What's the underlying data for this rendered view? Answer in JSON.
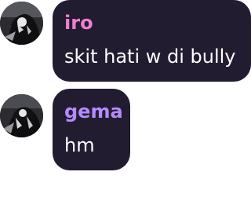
{
  "colors": {
    "bubble_bg": "#221c30",
    "message_text": "#ffffff"
  },
  "messages": [
    {
      "author": "iro",
      "author_color": "#ee7fd1",
      "text": "skit hati w di bully",
      "avatar_icon": "avatar-dark-character-icon"
    },
    {
      "author": "gema",
      "author_color": "#b48cff",
      "text": "hm",
      "avatar_icon": "avatar-dark-character-icon"
    }
  ]
}
